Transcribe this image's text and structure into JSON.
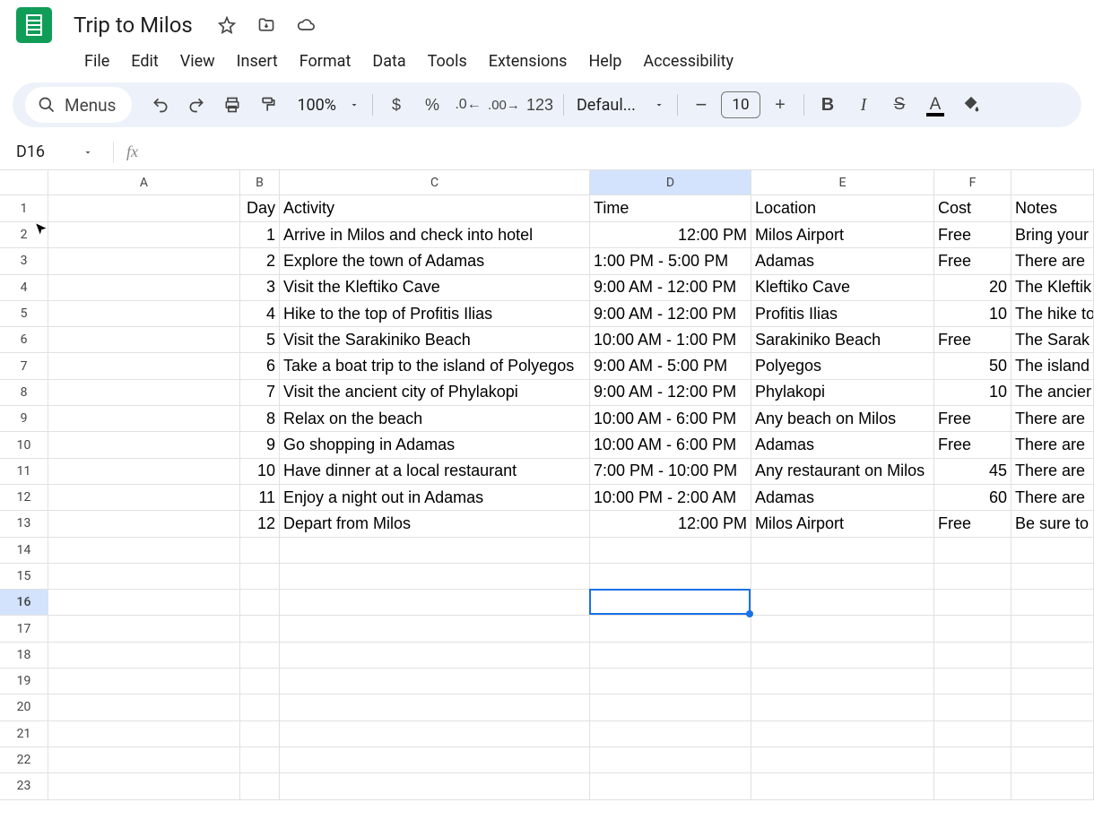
{
  "header": {
    "title": "Trip to Milos"
  },
  "menubar": [
    "File",
    "Edit",
    "View",
    "Insert",
    "Format",
    "Data",
    "Tools",
    "Extensions",
    "Help",
    "Accessibility"
  ],
  "toolbar": {
    "menus_label": "Menus",
    "zoom": "100%",
    "font": "Defaul...",
    "font_size": "10"
  },
  "namebox": "D16",
  "formula": "",
  "columns": [
    "A",
    "B",
    "C",
    "D",
    "E",
    "F"
  ],
  "col_widths": {
    "A": 214,
    "B": 44,
    "C": 346,
    "D": 180,
    "E": 204,
    "F": 86,
    "G": 92
  },
  "active_col_index": 3,
  "active_row_index": 15,
  "sheet": {
    "headers": {
      "B": "Day",
      "C": "Activity",
      "D": "Time",
      "E": "Location",
      "F": "Cost",
      "G": "Notes"
    },
    "rows": [
      {
        "B": "1",
        "C": "Arrive in Milos and check into hotel",
        "D": "12:00 PM",
        "D_align": "right",
        "E": "Milos Airport",
        "F": "Free",
        "G": "Bring your"
      },
      {
        "B": "2",
        "C": "Explore the town of Adamas",
        "D": "1:00 PM - 5:00 PM",
        "E": "Adamas",
        "F": "Free",
        "G": "There are"
      },
      {
        "B": "3",
        "C": "Visit the Kleftiko Cave",
        "D": "9:00 AM - 12:00 PM",
        "E": "Kleftiko Cave",
        "F": "20",
        "F_align": "right",
        "G": "The Kleftik"
      },
      {
        "B": "4",
        "C": "Hike to the top of Profitis Ilias",
        "D": "9:00 AM - 12:00 PM",
        "E": "Profitis Ilias",
        "F": "10",
        "F_align": "right",
        "G": "The hike to"
      },
      {
        "B": "5",
        "C": "Visit the Sarakiniko Beach",
        "D": "10:00 AM - 1:00 PM",
        "E": "Sarakiniko Beach",
        "F": "Free",
        "G": "The Sarak"
      },
      {
        "B": "6",
        "C": "Take a boat trip to the island of Polyegos",
        "D": "9:00 AM - 5:00 PM",
        "E": "Polyegos",
        "F": "50",
        "F_align": "right",
        "G": "The island"
      },
      {
        "B": "7",
        "C": "Visit the ancient city of Phylakopi",
        "D": "9:00 AM - 12:00 PM",
        "E": "Phylakopi",
        "F": "10",
        "F_align": "right",
        "G": "The ancier"
      },
      {
        "B": "8",
        "C": "Relax on the beach",
        "D": "10:00 AM - 6:00 PM",
        "E": "Any beach on Milos",
        "F": "Free",
        "G": "There are"
      },
      {
        "B": "9",
        "C": "Go shopping in Adamas",
        "D": "10:00 AM - 6:00 PM",
        "E": "Adamas",
        "F": "Free",
        "G": "There are"
      },
      {
        "B": "10",
        "C": "Have dinner at a local restaurant",
        "D": "7:00 PM - 10:00 PM",
        "E": "Any restaurant on Milos",
        "F": "45",
        "F_align": "right",
        "G": "There are"
      },
      {
        "B": "11",
        "C": "Enjoy a night out in Adamas",
        "D": "10:00 PM - 2:00 AM",
        "E": "Adamas",
        "F": "60",
        "F_align": "right",
        "G": "There are"
      },
      {
        "B": "12",
        "C": "Depart from Milos",
        "D": "12:00 PM",
        "D_align": "right",
        "E": "Milos Airport",
        "F": "Free",
        "G": "Be sure to"
      }
    ]
  },
  "total_display_rows": 23
}
